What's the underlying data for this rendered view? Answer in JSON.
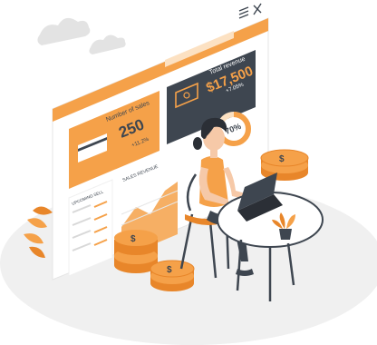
{
  "dashboard": {
    "sales_card": {
      "label": "Number of sales",
      "value": "250",
      "trend": "+11.2%"
    },
    "revenue_card": {
      "label": "Total revenue",
      "value": "$17,500",
      "trend": "+7.05%"
    },
    "donut": {
      "value": "70%",
      "fraction": 0.7
    },
    "sales_revenue_title": "SALES REVENUE",
    "upcoming_title": "UPCOMING SELL"
  },
  "colors": {
    "accent": "#F5A149",
    "accent_dark": "#E8862A",
    "panel_dark": "#3E4650",
    "ground": "#EFEFEF"
  },
  "icons": [
    "menu-icon",
    "close-icon",
    "dollar-coin-icon",
    "banknote-icon",
    "credit-card-icon",
    "plant-icon"
  ]
}
